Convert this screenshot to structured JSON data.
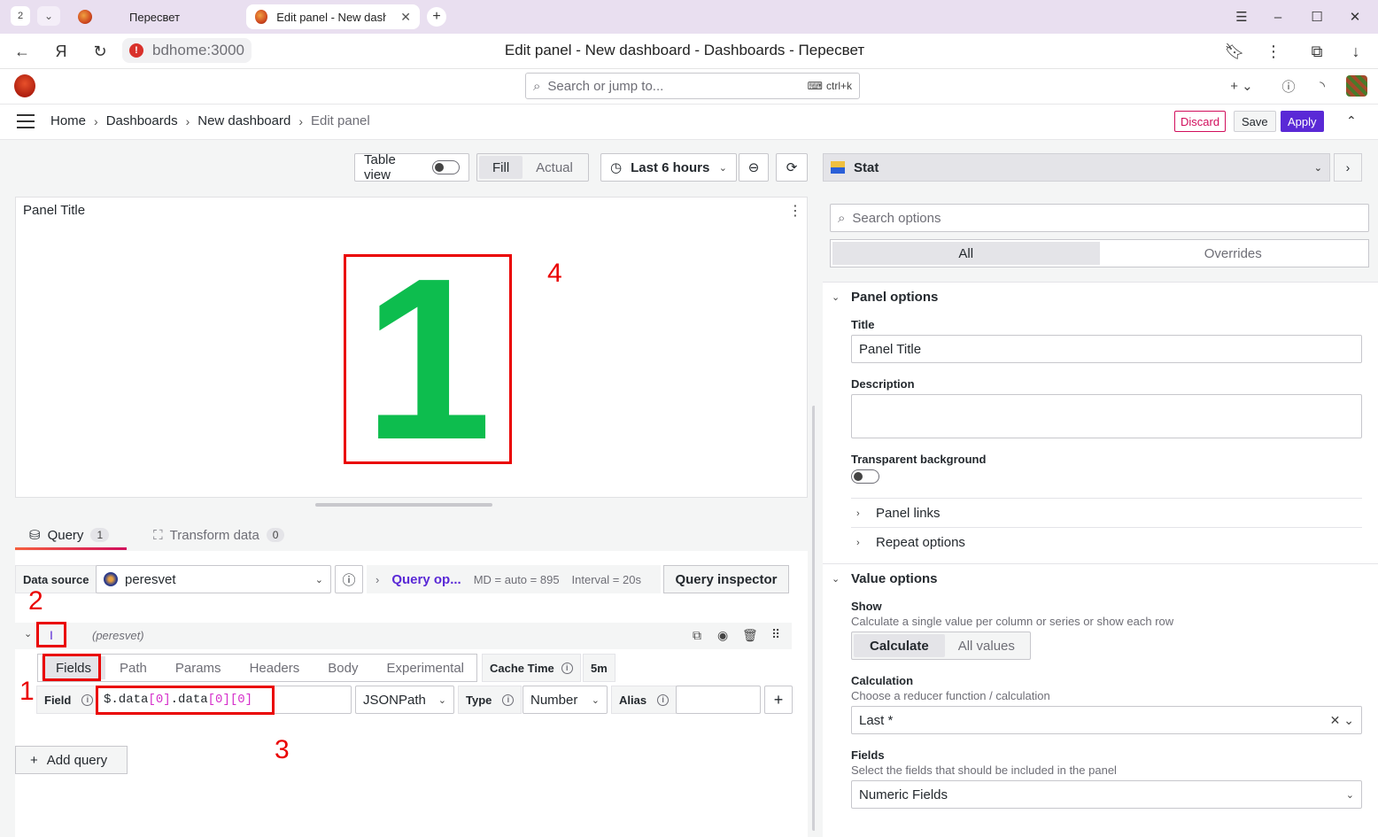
{
  "browser": {
    "tab_count": "2",
    "tabs": [
      {
        "title": "Пересвет"
      },
      {
        "title": "Edit panel - New dashb"
      }
    ],
    "url": "bdhome:3000",
    "page_title": "Edit panel - New dashboard - Dashboards - Пересвет"
  },
  "topnav": {
    "search_placeholder": "Search or jump to...",
    "shortcut": "ctrl+k"
  },
  "breadcrumb": [
    "Home",
    "Dashboards",
    "New dashboard",
    "Edit panel"
  ],
  "actions": {
    "discard": "Discard",
    "save": "Save",
    "apply": "Apply"
  },
  "toolbar": {
    "table_view": "Table view",
    "fill": "Fill",
    "actual": "Actual",
    "time_range": "Last 6 hours"
  },
  "panel": {
    "title": "Panel Title",
    "stat_value": "1"
  },
  "annotations": [
    "1",
    "2",
    "3",
    "4"
  ],
  "query_tabs": [
    {
      "label": "Query",
      "count": "1"
    },
    {
      "label": "Transform data",
      "count": "0"
    }
  ],
  "query": {
    "datasource_label": "Data source",
    "datasource": "peresvet",
    "query_options": "Query op...",
    "md": "MD = auto = 895",
    "interval": "Interval = 20s",
    "inspector": "Query inspector",
    "ref_id": "I",
    "ref_source": "(peresvet)",
    "subtabs": [
      "Fields",
      "Path",
      "Params",
      "Headers",
      "Body",
      "Experimental"
    ],
    "cache_time_label": "Cache Time",
    "cache_time": "5m",
    "field_label": "Field",
    "field_value_parts": [
      "$.data",
      "[0]",
      ".data",
      "[0]",
      "[0]"
    ],
    "parser": "JSONPath",
    "type_label": "Type",
    "type_value": "Number",
    "alias_label": "Alias",
    "add_query": "Add query"
  },
  "options": {
    "visualization": "Stat",
    "search_placeholder": "Search options",
    "tabs": [
      "All",
      "Overrides"
    ],
    "panel_options": {
      "heading": "Panel options",
      "title_label": "Title",
      "title_value": "Panel Title",
      "description_label": "Description",
      "transparent_label": "Transparent background",
      "panel_links": "Panel links",
      "repeat_options": "Repeat options"
    },
    "value_options": {
      "heading": "Value options",
      "show_label": "Show",
      "show_desc": "Calculate a single value per column or series or show each row",
      "show_calculate": "Calculate",
      "show_all": "All values",
      "calc_label": "Calculation",
      "calc_desc": "Choose a reducer function / calculation",
      "calc_value": "Last *",
      "fields_label": "Fields",
      "fields_desc": "Select the fields that should be included in the panel",
      "fields_value": "Numeric Fields"
    }
  },
  "colors": {
    "accent": "#5a29d6",
    "stat_green": "#0dbd4e",
    "annotation_red": "#ea0000",
    "discard": "#d10e5c"
  }
}
